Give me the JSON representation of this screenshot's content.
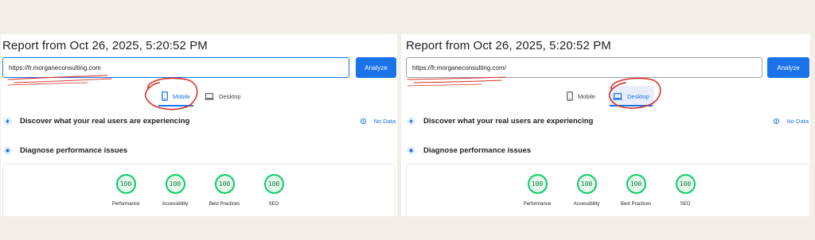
{
  "colors": {
    "accent": "#1a73e8",
    "pass_green": "#0cce6b",
    "annotation_red": "#d93025"
  },
  "reports": [
    {
      "title": "Report from Oct 26, 2025, 5:20:52 PM",
      "url_value": "https://fr.morganeconsulting.com",
      "analyze_label": "Analyze",
      "tabs": {
        "mobile": "Mobile",
        "desktop": "Desktop",
        "active": "mobile"
      },
      "real_users_heading": "Discover what your real users are experiencing",
      "no_data_label": "No Data",
      "diagnose_heading": "Diagnose performance issues",
      "scores": [
        {
          "label": "Performance",
          "value": "100"
        },
        {
          "label": "Accessibility",
          "value": "100"
        },
        {
          "label": "Best Practices",
          "value": "100"
        },
        {
          "label": "SEO",
          "value": "100"
        }
      ]
    },
    {
      "title": "Report from Oct 26, 2025, 5:20:52 PM",
      "url_value": "https://fr.morganeconsulting.com/",
      "analyze_label": "Analyze",
      "tabs": {
        "mobile": "Mobile",
        "desktop": "Desktop",
        "active": "desktop"
      },
      "real_users_heading": "Discover what your real users are experiencing",
      "no_data_label": "No Data",
      "diagnose_heading": "Diagnose performance issues",
      "scores": [
        {
          "label": "Performance",
          "value": "100"
        },
        {
          "label": "Accessibility",
          "value": "100"
        },
        {
          "label": "Best Practices",
          "value": "100"
        },
        {
          "label": "SEO",
          "value": "100"
        }
      ]
    }
  ],
  "icons": {
    "mobile_tab": "phone-icon",
    "desktop_tab": "laptop-icon",
    "real_users": "upload-arrow-icon",
    "diagnose": "gauge-dot-icon",
    "no_data": "info-icon"
  }
}
